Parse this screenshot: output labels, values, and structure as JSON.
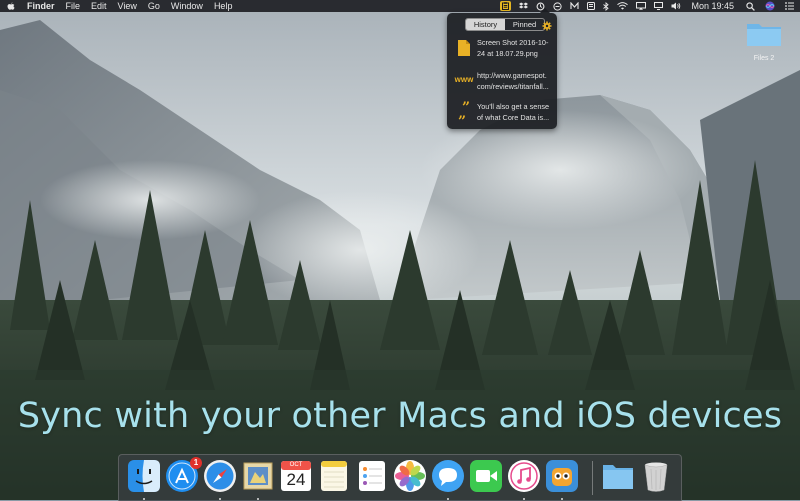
{
  "menubar": {
    "apple_icon": "apple-logo-icon",
    "app_name": "Finder",
    "menus": [
      "File",
      "Edit",
      "View",
      "Go",
      "Window",
      "Help"
    ],
    "extras_icons": [
      "clipboard-icon",
      "dropbox-icon",
      "sync-icon",
      "clock-icon",
      "mail-icon",
      "battery-icon",
      "bluetooth-icon",
      "wifi-icon",
      "display-icon",
      "airplay-icon",
      "volume-icon"
    ],
    "clock": "Mon 19:45",
    "right_icons": [
      "spotlight-icon",
      "siri-icon",
      "notification-center-icon"
    ]
  },
  "popover": {
    "tabs": [
      {
        "label": "History",
        "selected": true
      },
      {
        "label": "Pinned",
        "selected": false
      }
    ],
    "settings_icon": "gear-icon",
    "items": [
      {
        "type": "file",
        "icon": "document-icon",
        "text": "Screen Shot 2016-10-\n24 at 18.07.29.png"
      },
      {
        "type": "link",
        "icon": "www",
        "text": "http://www.gamespot.\ncom/reviews/titanfall..."
      },
      {
        "type": "text",
        "icon": "quote-icon",
        "text": "You'll also get a sense\nof what Core Data is..."
      }
    ]
  },
  "desktop": {
    "folder_label": "Files 2"
  },
  "caption": "Sync with your other Macs and iOS devices",
  "dock": {
    "items": [
      {
        "name": "finder",
        "running": true
      },
      {
        "name": "app-store",
        "running": false,
        "badge": "1"
      },
      {
        "name": "safari",
        "running": true
      },
      {
        "name": "mail",
        "running": true
      },
      {
        "name": "calendar",
        "running": false,
        "month": "OCT",
        "day": "24"
      },
      {
        "name": "notes",
        "running": false
      },
      {
        "name": "reminders",
        "running": false
      },
      {
        "name": "photos",
        "running": false
      },
      {
        "name": "messages",
        "running": true
      },
      {
        "name": "facetime",
        "running": false
      },
      {
        "name": "itunes",
        "running": true
      },
      {
        "name": "tweetbot",
        "running": true
      },
      {
        "name": "downloads-folder",
        "running": false
      },
      {
        "name": "trash",
        "running": false
      }
    ]
  },
  "colors": {
    "accent": "#e8b126",
    "caption": "#a7e1ec"
  }
}
